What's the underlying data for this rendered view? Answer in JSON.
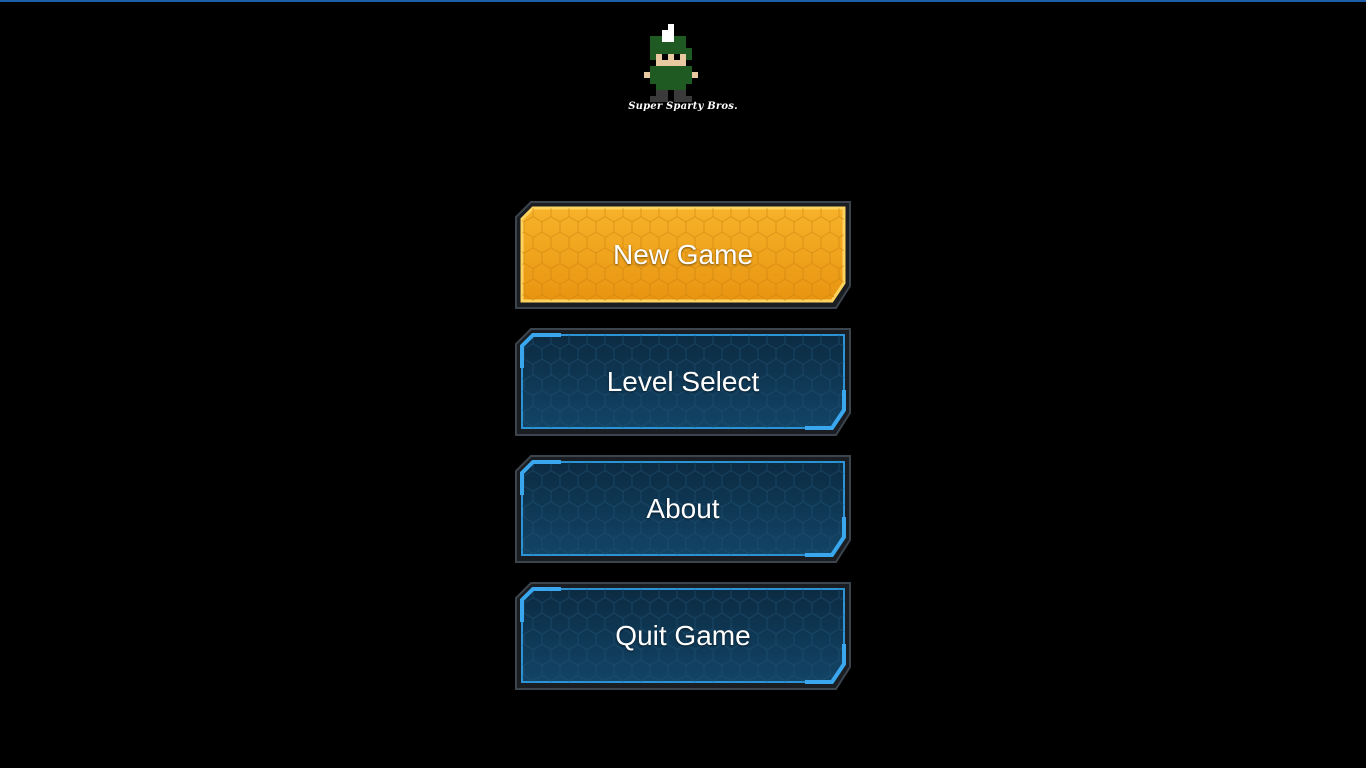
{
  "game": {
    "logo_text": "Super Sparty Bros."
  },
  "menu": {
    "new_game": "New Game",
    "level_select": "Level Select",
    "about": "About",
    "quit_game": "Quit Game",
    "selected_item": "New Game"
  },
  "colors": {
    "background": "#000000",
    "top_border": "#1c5ea8",
    "button_selected_fill": "#f2a51c",
    "button_selected_edge": "#ffd45e",
    "button_default_fill": "#0f3550",
    "button_default_edge": "#2b93d6",
    "button_frame": "#3c444d",
    "text": "#ffffff"
  }
}
